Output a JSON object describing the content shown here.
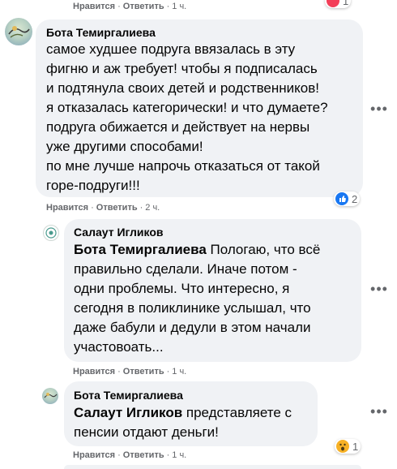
{
  "top": {
    "actions": {
      "like": "Нравится",
      "reply": "Ответить",
      "time": "1 ч."
    },
    "reactions": "1"
  },
  "comments": [
    {
      "author": "Бота Темиргалиева",
      "text": "самое худшее подруга ввязалась в эту\nфигню и аж требует! чтобы я подписалась\nи подтянула своих детей и родственников!\nя отказалась категорически! и что думаете?\nподруга обижается и действует на нервы\nуже другими способами!\nпо мне лучше напрочь отказаться от такой\nгоре-подруги!!!",
      "reactions": "2",
      "actions": {
        "like": "Нравится",
        "reply": "Ответить",
        "time": "2 ч."
      }
    },
    {
      "author": "Салаут Игликов",
      "mention": "Бота Темиргалиева",
      "text": " Пологаю, что всё\nправильно сделали. Иначе потом -\nодни проблемы. Что интересно, я\nсегодня в поликлинике услышал, что\nдаже бабули и дедули в этом начали\nучастовоать...",
      "actions": {
        "like": "Нравится",
        "reply": "Ответить",
        "time": "1 ч."
      }
    },
    {
      "author": "Бота Темиргалиева",
      "mention": "Салаут Игликов",
      "text": " представляете с\nпенсии отдают деньги!",
      "reactions": "1",
      "actions": {
        "like": "Нравится",
        "reply": "Ответить",
        "time": "1 ч."
      }
    }
  ],
  "icons": {
    "more": "more-options-icon",
    "like_reaction": "like-reaction-icon",
    "love_reaction": "love-reaction-icon",
    "wow_reaction": "wow-reaction-icon"
  },
  "colors": {
    "bubble": "#f0f2f5",
    "secondary_text": "#65676b",
    "like_blue": "#1877f2",
    "love_red": "#f33e58",
    "wow_yellow": "#f7b125"
  }
}
